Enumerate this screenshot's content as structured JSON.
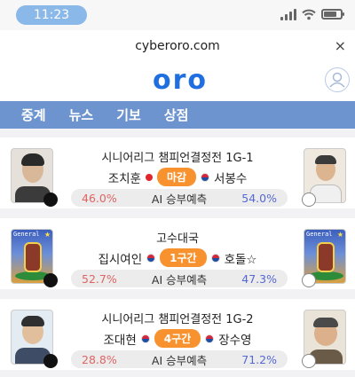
{
  "status_bar": {
    "time": "11:23"
  },
  "browser": {
    "url": "cyberoro.com",
    "close_glyph": "×"
  },
  "header": {
    "logo_letters": [
      "o",
      "r",
      "o"
    ]
  },
  "nav": {
    "items": [
      "중계",
      "뉴스",
      "기보",
      "상점"
    ]
  },
  "matches": [
    {
      "title": "시니어리그 챔피언결정전 1G-1",
      "player_left": "조치훈",
      "flag_left": "japan",
      "status": "마감",
      "flag_right": "korea",
      "player_right": "서봉수",
      "pct_left": "46.0%",
      "ai_label": "AI 승부예측",
      "pct_right": "54.0%",
      "avatar_left": "photo",
      "avatar_right": "photo"
    },
    {
      "title": "고수대국",
      "player_left": "집시여인",
      "flag_left": "korea",
      "status": "1구간",
      "flag_right": "korea",
      "player_right": "호돌☆",
      "pct_left": "52.7%",
      "ai_label": "AI 승부예측",
      "pct_right": "47.3%",
      "avatar_left": "general",
      "avatar_right": "general"
    },
    {
      "title": "시니어리그 챔피언결정전 1G-2",
      "player_left": "조대현",
      "flag_left": "korea",
      "status": "4구간",
      "flag_right": "korea",
      "player_right": "장수영",
      "pct_left": "28.8%",
      "ai_label": "AI 승부예측",
      "pct_right": "71.2%",
      "avatar_left": "photo",
      "avatar_right": "photo"
    }
  ],
  "general_label": "General",
  "colors": {
    "accent": "#1f6fe0",
    "nav_bg": "#6d94cf",
    "badge": "#f7922f",
    "pct_left": "#e06464",
    "pct_right": "#5568d6"
  }
}
